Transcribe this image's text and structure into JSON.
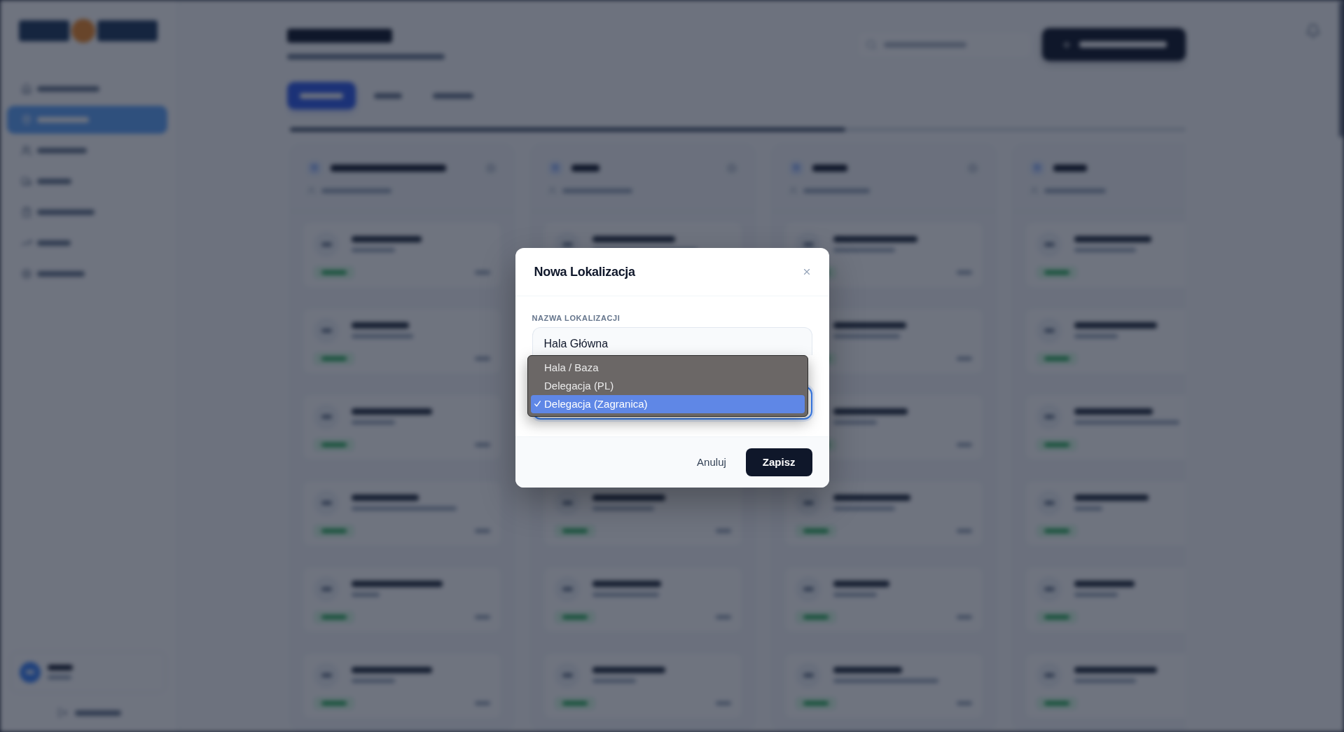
{
  "dialog": {
    "title": "Nowa Lokalizacja",
    "name_field": {
      "label": "NAZWA LOKALIZACJI",
      "value": "Hala Główna"
    },
    "type_select": {
      "focused": true,
      "expanded": true,
      "options": [
        {
          "label": "Hala / Baza",
          "selected": false
        },
        {
          "label": "Delegacja (PL)",
          "selected": false
        },
        {
          "label": "Delegacja (Zagranica)",
          "selected": true
        }
      ]
    },
    "buttons": {
      "cancel": "Anuluj",
      "save": "Zapisz"
    }
  }
}
